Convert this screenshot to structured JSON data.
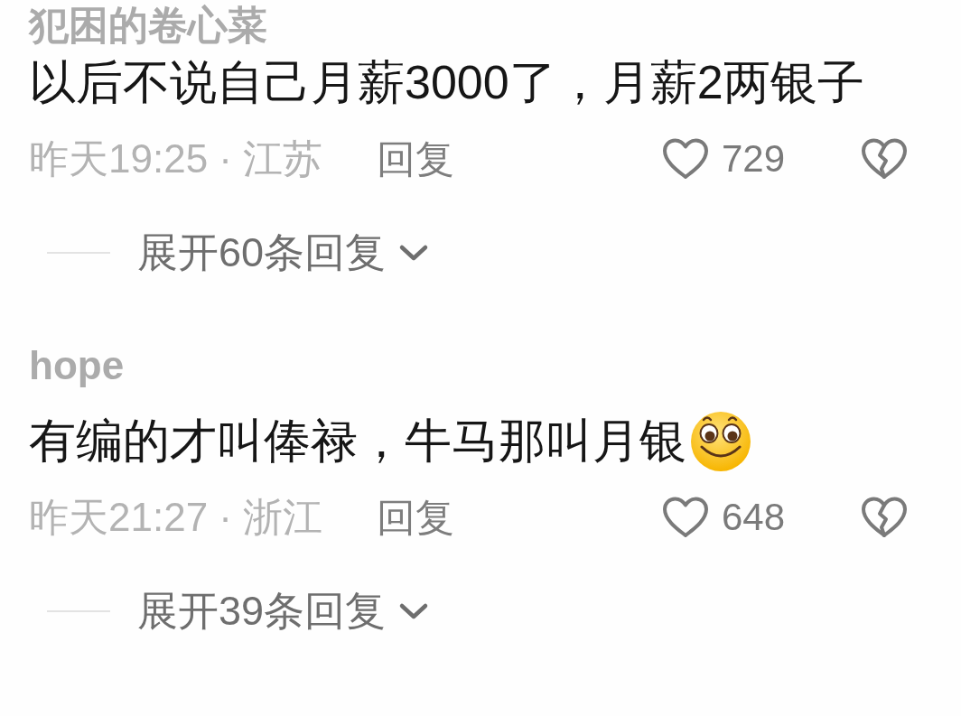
{
  "comments": [
    {
      "user": "犯困的卷心菜",
      "text": "以后不说自己月薪3000了，月薪2两银子",
      "emoji": false,
      "meta": "昨天19:25 · 江苏",
      "reply": "回复",
      "liked": false,
      "likes": "729",
      "disliked": false,
      "expand": "展开60条回复"
    },
    {
      "user": "hope",
      "text": "有编的才叫俸禄，牛马那叫月银",
      "emoji": true,
      "meta": "昨天21:27 · 浙江",
      "reply": "回复",
      "liked": false,
      "likes": "648",
      "disliked": false,
      "expand": "展开39条回复"
    }
  ]
}
